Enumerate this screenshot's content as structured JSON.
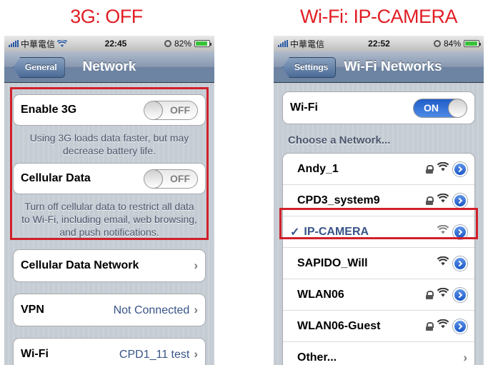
{
  "captions": {
    "left": "3G: OFF",
    "right": "Wi-Fi: IP-CAMERA"
  },
  "left_phone": {
    "status": {
      "carrier": "中華電信",
      "time": "22:45",
      "battery": "82%",
      "battery_level": 0.82
    },
    "nav": {
      "back": "General",
      "title": "Network"
    },
    "enable_3g": {
      "label": "Enable 3G",
      "toggle": "OFF"
    },
    "note_3g": "Using 3G loads data faster, but may decrease battery life.",
    "cellular_data": {
      "label": "Cellular Data",
      "toggle": "OFF"
    },
    "note_cellular": "Turn off cellular data to restrict all data to Wi-Fi, including email, web browsing, and push notifications.",
    "cellular_network": {
      "label": "Cellular Data Network"
    },
    "vpn": {
      "label": "VPN",
      "value": "Not Connected"
    },
    "wifi": {
      "label": "Wi-Fi",
      "value": "CPD1_11 test"
    }
  },
  "right_phone": {
    "status": {
      "carrier": "中華電信",
      "time": "22:52",
      "battery": "84%",
      "battery_level": 0.84
    },
    "nav": {
      "back": "Settings",
      "title": "Wi-Fi Networks"
    },
    "wifi": {
      "label": "Wi-Fi",
      "toggle": "ON"
    },
    "section_label": "Choose a Network...",
    "networks": [
      {
        "name": "Andy_1",
        "locked": true
      },
      {
        "name": "CPD3_system9",
        "locked": true
      },
      {
        "name": "IP-CAMERA",
        "locked": false,
        "selected": true,
        "check": "✓"
      },
      {
        "name": "SAPIDO_Will",
        "locked": false
      },
      {
        "name": "WLAN06",
        "locked": true
      },
      {
        "name": "WLAN06-Guest",
        "locked": true
      }
    ],
    "other": "Other..."
  },
  "colors": {
    "caption_red": "#e01e25",
    "highlight_red": "#d1202a",
    "link_blue": "#385487",
    "toggle_on_blue": "#1f5dc8"
  }
}
